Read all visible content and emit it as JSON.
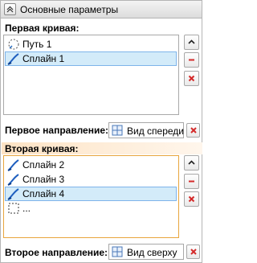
{
  "header": {
    "title": "Основные параметры"
  },
  "first_curve": {
    "label": "Первая кривая:",
    "items": [
      {
        "label": "Путь 1",
        "icon": "path-icon",
        "selected": false
      },
      {
        "label": "Сплайн 1",
        "icon": "spline-icon",
        "selected": true
      }
    ]
  },
  "first_direction": {
    "label": "Первое направление:",
    "value": "Вид спереди"
  },
  "second_curve": {
    "label": "Вторая кривая:",
    "items": [
      {
        "label": "Сплайн 2",
        "icon": "spline-icon",
        "selected": false
      },
      {
        "label": "Сплайн 3",
        "icon": "spline-icon",
        "selected": false
      },
      {
        "label": "Сплайн 4",
        "icon": "spline-icon",
        "selected": true
      },
      {
        "label": "...",
        "icon": "empty-selection-icon",
        "selected": false
      }
    ]
  },
  "second_direction": {
    "label": "Второе направление:",
    "value": "Вид сверху"
  },
  "colors": {
    "accent_orange": "#e8a53d",
    "selection_fill": "#d3ebf9",
    "remove_red": "#d42a2a"
  }
}
